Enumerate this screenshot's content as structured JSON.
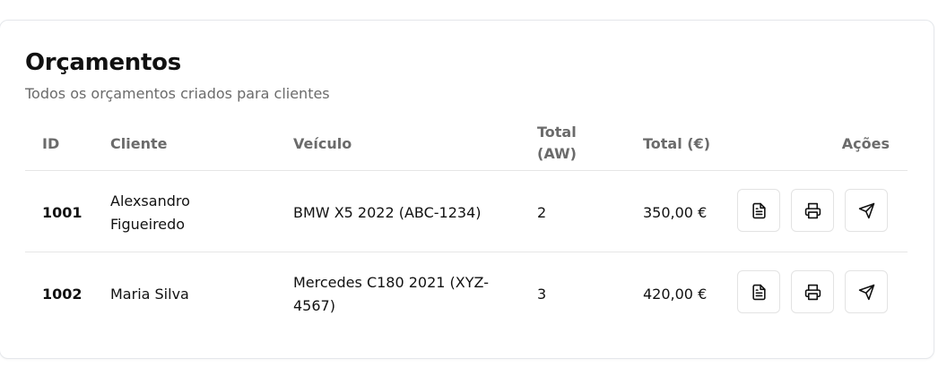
{
  "header": {
    "title": "Orçamentos",
    "subtitle": "Todos os orçamentos criados para clientes"
  },
  "table": {
    "columns": {
      "id": "ID",
      "client": "Cliente",
      "vehicle": "Veículo",
      "total_aw_line1": "Total",
      "total_aw_line2": "(AW)",
      "total_eur": "Total (€)",
      "actions": "Ações"
    },
    "rows": [
      {
        "id": "1001",
        "client_line1": "Alexsandro",
        "client_line2": "Figueiredo",
        "vehicle_line1": "BMW X5 2022 (ABC-1234)",
        "vehicle_line2": "",
        "total_aw": "2",
        "total_eur": "350,00 €"
      },
      {
        "id": "1002",
        "client_line1": "Maria Silva",
        "client_line2": "",
        "vehicle_line1": "Mercedes C180 2021 (XYZ-",
        "vehicle_line2": "4567)",
        "total_aw": "3",
        "total_eur": "420,00 €"
      }
    ],
    "row_actions": [
      {
        "icon": "document-icon"
      },
      {
        "icon": "printer-icon"
      },
      {
        "icon": "send-icon"
      }
    ]
  }
}
